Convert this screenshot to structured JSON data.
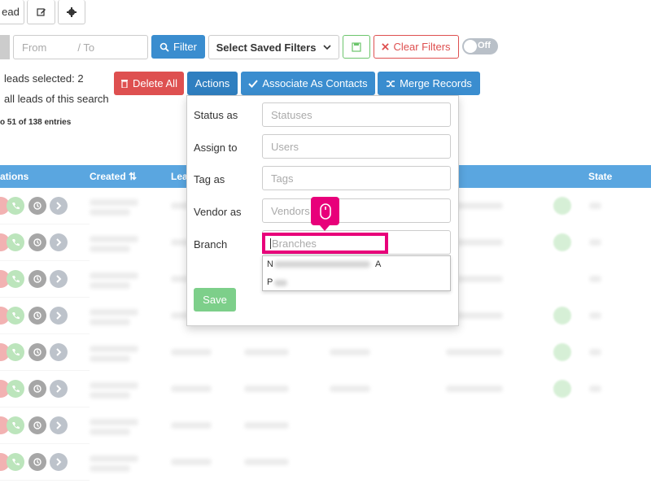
{
  "toolbar": {
    "lead_tab_label": "ead"
  },
  "filters": {
    "from_placeholder": "From",
    "to_placeholder": "/ To",
    "filter_label": "Filter",
    "saved_filters_label": "Select Saved Filters",
    "clear_filters_label": "Clear Filters",
    "toggle_label": "Off"
  },
  "selection": {
    "leads_selected": "leads selected: 2",
    "all_leads": "all leads of this search",
    "entries": "o 51 of 138 entries"
  },
  "actions": {
    "delete_all": "Delete All",
    "actions": "Actions",
    "associate": "Associate As Contacts",
    "merge": "Merge Records"
  },
  "table": {
    "headers": [
      "ations",
      "Created",
      "Lea",
      "State"
    ]
  },
  "dropdown": {
    "status_label": "Status as",
    "status_placeholder": "Statuses",
    "assign_label": "Assign to",
    "assign_placeholder": "Users",
    "tag_label": "Tag as",
    "tag_placeholder": "Tags",
    "vendor_label": "Vendor as",
    "vendor_placeholder": "Vendors",
    "branch_label": "Branch",
    "branch_placeholder": "Branches",
    "options": [
      "N",
      "A",
      "P"
    ],
    "save_label": "Save"
  },
  "colors": {
    "primary": "#3a8dcf",
    "danger": "#de5050",
    "success": "#6cc56c",
    "highlight": "#e8007a",
    "header_bar": "#5aa6e0"
  }
}
